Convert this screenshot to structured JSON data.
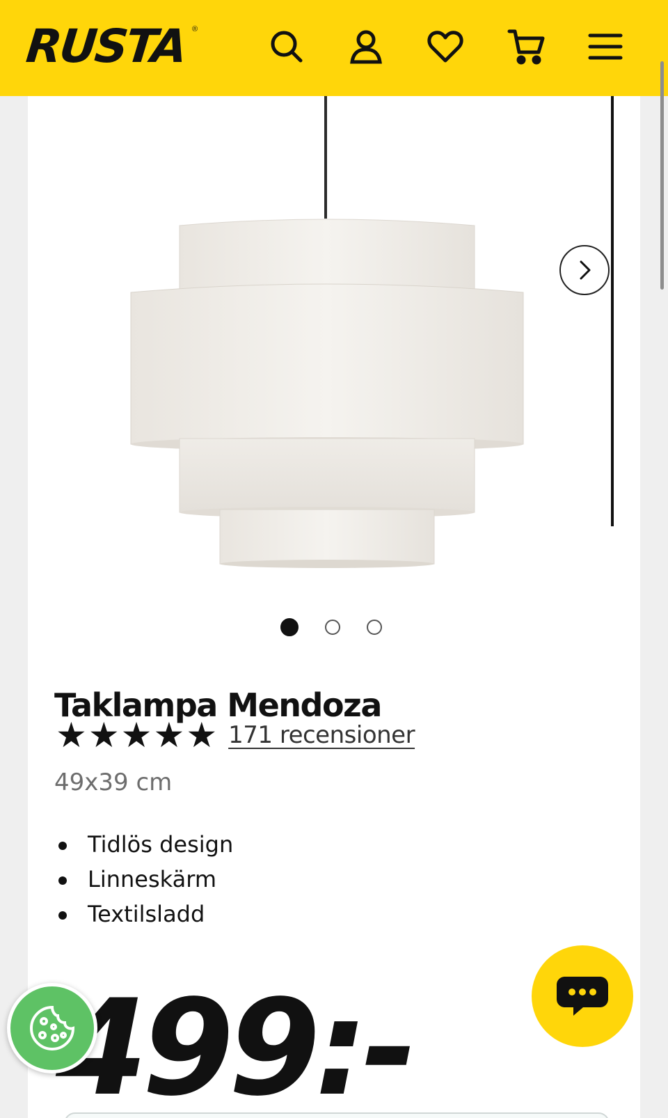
{
  "header": {
    "logo_text": "RUSTA",
    "logo_mark": "®",
    "icons": [
      "search-icon",
      "user-icon",
      "heart-icon",
      "cart-icon",
      "menu-icon"
    ],
    "background": "#ffd60a"
  },
  "gallery": {
    "slide_count": 3,
    "active_index": 0,
    "next_icon": "chevron-right-icon"
  },
  "product": {
    "title": "Taklampa Mendoza",
    "stars": "★★★★★",
    "rating_value": 5,
    "reviews_link": "171 recensioner",
    "dimensions": "49x39 cm",
    "features": [
      "Tidlös design",
      "Linneskärm",
      "Textilsladd"
    ],
    "price": "499:-"
  },
  "floating": {
    "cookie_icon": "cookie-icon",
    "cookie_color": "#5ec265",
    "chat_icon": "chat-bubble-icon",
    "chat_color": "#ffd60a"
  }
}
